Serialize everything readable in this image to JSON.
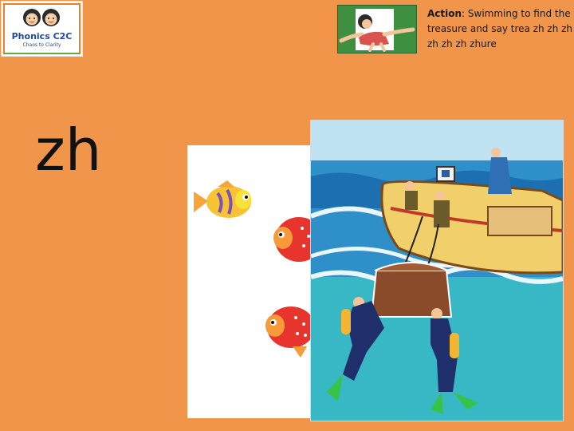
{
  "logo": {
    "brand": "Phonics C2C",
    "tagline": "Chaos to Clarity"
  },
  "action": {
    "label": "Action",
    "text": ": Swimming to find the treasure and say trea zh zh zh zh zh zh zhure"
  },
  "phoneme": "zh"
}
